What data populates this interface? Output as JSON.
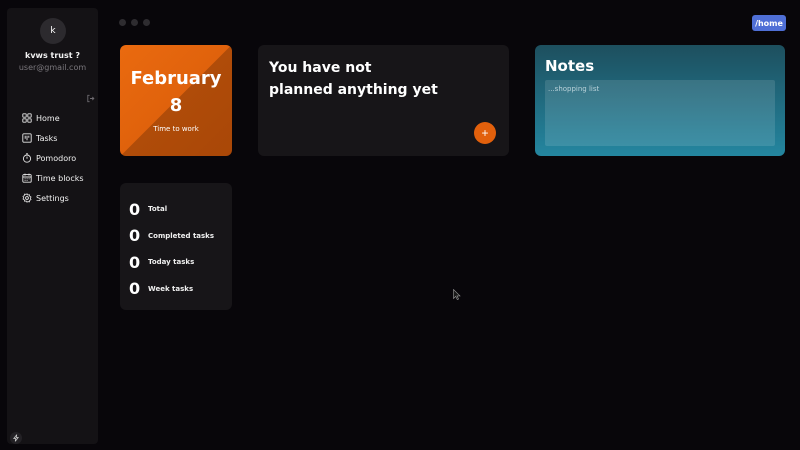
{
  "user": {
    "initial": "k",
    "name": "kvws trust ?",
    "email": "user@gmail.com"
  },
  "nav": {
    "items": [
      {
        "label": "Home",
        "icon": "grid-icon"
      },
      {
        "label": "Tasks",
        "icon": "kanban-icon"
      },
      {
        "label": "Pomodoro",
        "icon": "timer-icon"
      },
      {
        "label": "Time blocks",
        "icon": "calendar-icon"
      },
      {
        "label": "Settings",
        "icon": "gear-icon"
      }
    ]
  },
  "route": "/home",
  "date_card": {
    "month": "February",
    "day": "8",
    "subtitle": "Time to work"
  },
  "plan_card": {
    "line1": "You have not",
    "line2": "planned anything yet",
    "add_label": "+"
  },
  "notes": {
    "title": "Notes",
    "placeholder": "...shopping list"
  },
  "stats": [
    {
      "value": "0",
      "label": "Total"
    },
    {
      "value": "0",
      "label": "Completed tasks"
    },
    {
      "value": "0",
      "label": "Today tasks"
    },
    {
      "value": "0",
      "label": "Week tasks"
    }
  ],
  "colors": {
    "background": "#08060a",
    "sidebar": "#141215",
    "accent_orange": "#e2600c",
    "accent_teal": "#2486a0",
    "route_badge": "#4f6fd6"
  }
}
